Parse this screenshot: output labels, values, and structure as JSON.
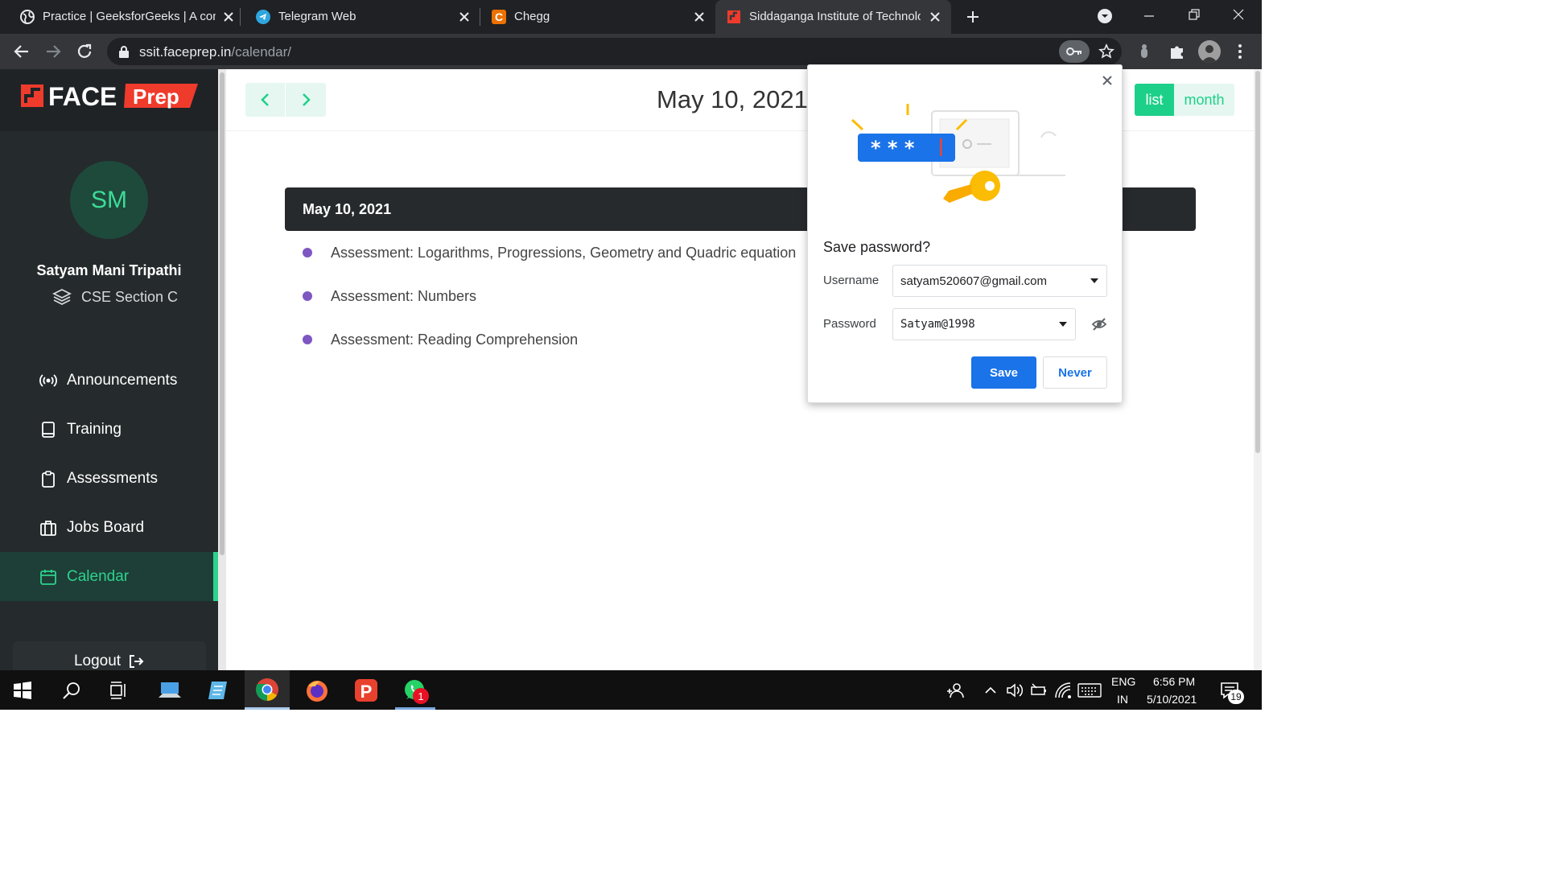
{
  "browser": {
    "tabs": [
      {
        "title": "Practice | GeeksforGeeks | A comp",
        "icon": "globe-icon"
      },
      {
        "title": "Telegram Web",
        "icon": "telegram-icon"
      },
      {
        "title": "Chegg",
        "icon": "chegg-icon"
      },
      {
        "title": "Siddaganga Institute of Technolo",
        "icon": "faceprep-icon",
        "active": true
      }
    ],
    "url_host": "ssit.faceprep.in",
    "url_path": "/calendar/"
  },
  "brand": {
    "logo_text_1": "FACE",
    "logo_text_2": "Prep",
    "accent": "#2ed18d",
    "logo_red": "#ef3b2c"
  },
  "user": {
    "initials": "SM",
    "name": "Satyam Mani Tripathi",
    "section": "CSE Section C"
  },
  "menu": [
    {
      "label": "Announcements",
      "icon": "broadcast-icon"
    },
    {
      "label": "Training",
      "icon": "book-icon"
    },
    {
      "label": "Assessments",
      "icon": "clipboard-icon"
    },
    {
      "label": "Jobs Board",
      "icon": "briefcase-icon"
    },
    {
      "label": "Calendar",
      "icon": "calendar-icon",
      "active": true
    }
  ],
  "logout_label": "Logout",
  "calendar": {
    "title": "May 10, 2021",
    "views": {
      "list": "list",
      "month": "month"
    },
    "active_view": "list",
    "day_heading": "May 10, 2021",
    "events": [
      "Assessment: Logarithms, Progressions, Geometry and Quadric equation",
      "Assessment: Numbers",
      "Assessment: Reading Comprehension"
    ],
    "event_dot_color": "#7e57c2"
  },
  "save_password": {
    "title": "Save password?",
    "username_label": "Username",
    "username_value": "satyam520607@gmail.com",
    "password_label": "Password",
    "password_value": "Satyam@1998",
    "save_label": "Save",
    "never_label": "Never"
  },
  "taskbar": {
    "language_1": "ENG",
    "language_2": "IN",
    "time": "6:56 PM",
    "date": "5/10/2021",
    "whatsapp_badge": "1",
    "notification_count": "19"
  }
}
